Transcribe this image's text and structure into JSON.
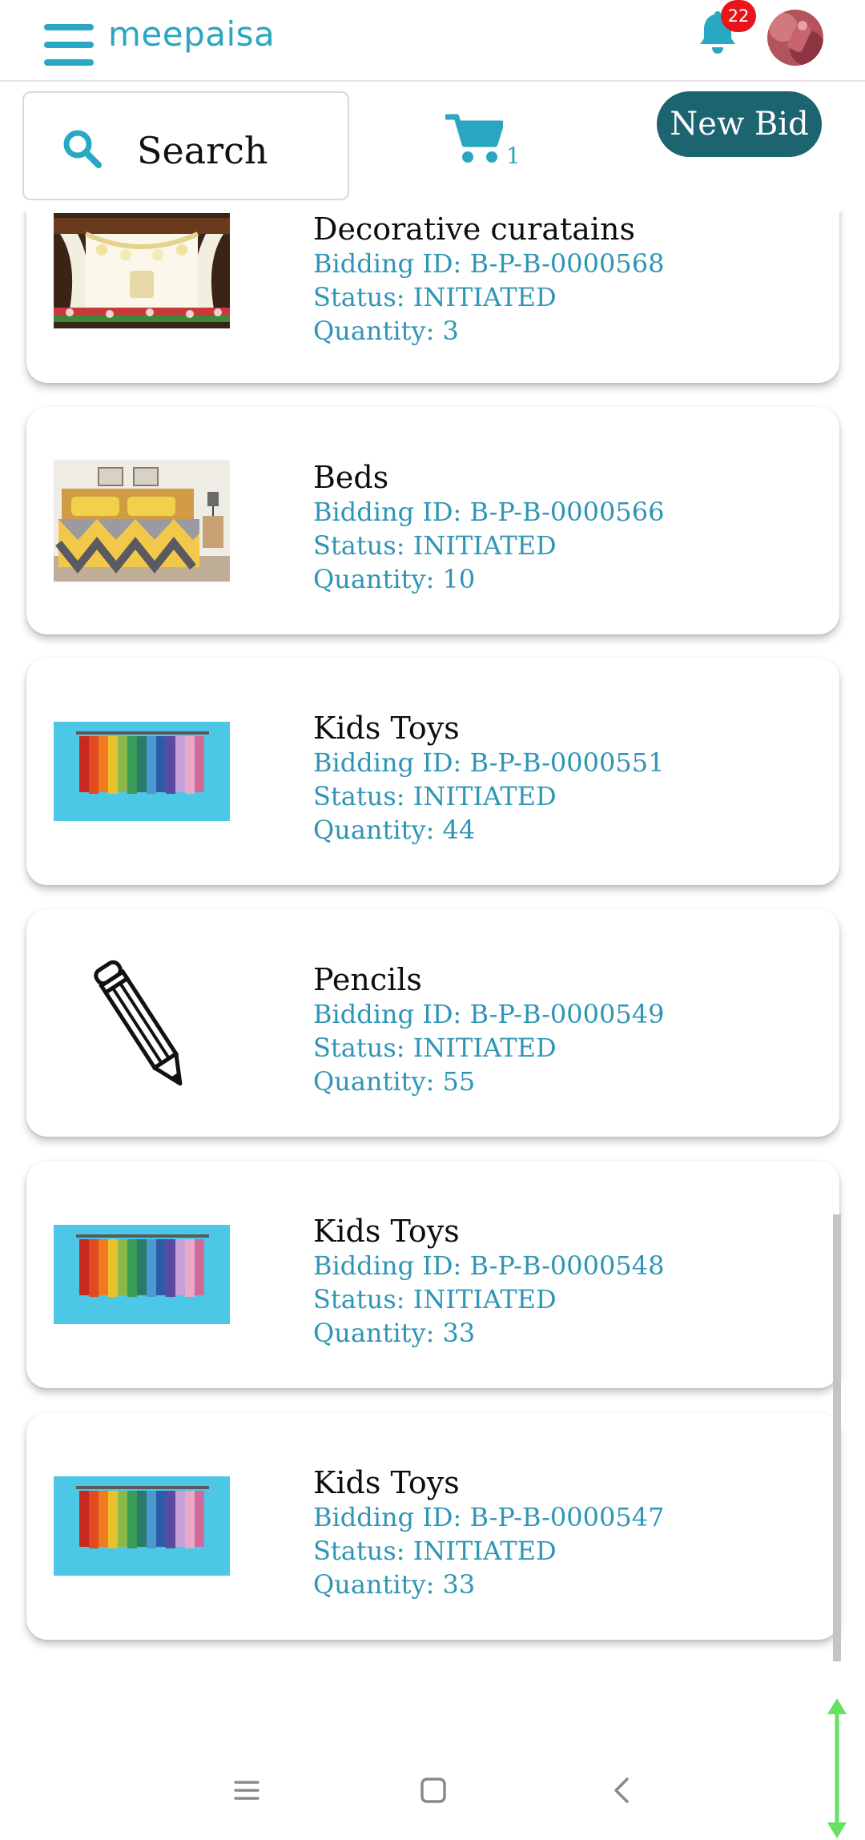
{
  "app": {
    "brand": "meepaisa",
    "notification_count": "22"
  },
  "search": {
    "label": "Search"
  },
  "cart": {
    "count": "1"
  },
  "new_bid": {
    "label": "New Bid"
  },
  "bids": [
    {
      "title": "Decorative curatains",
      "bidding_id": "Bidding ID: B-P-B-0000568",
      "status": "Status: INITIATED",
      "quantity": "Quantity: 3",
      "image": "stage-decoration"
    },
    {
      "title": "Beds",
      "bidding_id": "Bidding ID: B-P-B-0000566",
      "status": "Status: INITIATED",
      "quantity": "Quantity: 10",
      "image": "bed"
    },
    {
      "title": "Kids Toys",
      "bidding_id": "Bidding ID: B-P-B-0000551",
      "status": "Status: INITIATED",
      "quantity": "Quantity: 44",
      "image": "clothes-rack"
    },
    {
      "title": "Pencils",
      "bidding_id": "Bidding ID: B-P-B-0000549",
      "status": "Status: INITIATED",
      "quantity": "Quantity: 55",
      "image": "pencil"
    },
    {
      "title": "Kids Toys",
      "bidding_id": "Bidding ID: B-P-B-0000548",
      "status": "Status: INITIATED",
      "quantity": "Quantity: 33",
      "image": "clothes-rack"
    },
    {
      "title": "Kids Toys",
      "bidding_id": "Bidding ID: B-P-B-0000547",
      "status": "Status: INITIATED",
      "quantity": "Quantity: 33",
      "image": "clothes-rack"
    }
  ],
  "icons": {
    "menu": "hamburger-menu-icon",
    "notifications": "bell-icon",
    "search": "search-icon",
    "cart": "cart-icon",
    "nav_recents": "recents-icon",
    "nav_home": "home-icon",
    "nav_back": "back-icon"
  },
  "colors": {
    "accent": "#2aa6c0",
    "primary_button": "#1b6470",
    "badge": "#e8151b",
    "detail_text": "#2f95b6"
  }
}
